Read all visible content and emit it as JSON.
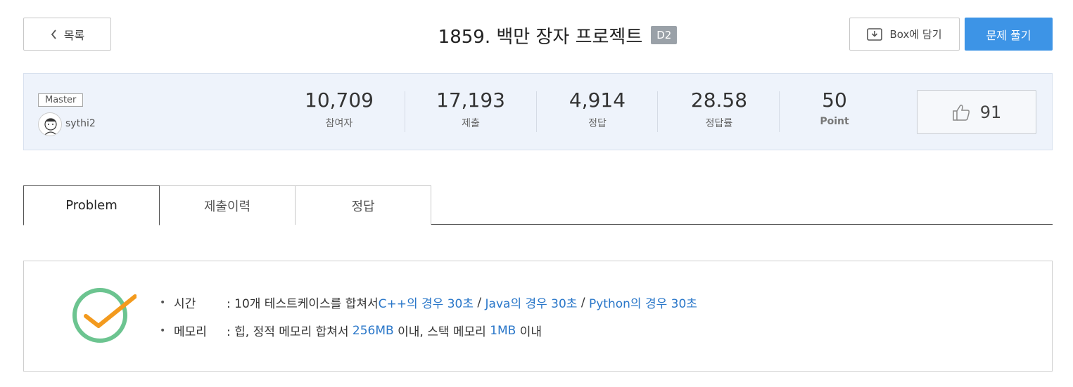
{
  "header": {
    "back_label": "목록",
    "title": "1859. 백만 장자 프로젝트",
    "level": "D2",
    "box_label": "Box에 담기",
    "solve_label": "문제 풀기"
  },
  "stats": {
    "rank": "Master",
    "username": "sythi2",
    "participants_value": "10,709",
    "participants_label": "참여자",
    "submissions_value": "17,193",
    "submissions_label": "제출",
    "correct_value": "4,914",
    "correct_label": "정답",
    "rate_value": "28.58",
    "rate_label": "정답률",
    "point_value": "50",
    "point_label": "Point",
    "likes": "91"
  },
  "tabs": {
    "problem": "Problem",
    "history": "제출이력",
    "answer": "정답"
  },
  "constraints": {
    "bullet": "•",
    "time_key": "시간",
    "time_prefix": ": 10개 테스트케이스를 합쳐서 ",
    "cpp": "C++의 경우 30초",
    "sep1": " / ",
    "java": "Java의 경우 30초",
    "sep2": " / ",
    "python": "Python의 경우 30초",
    "memory_key": "메모리",
    "memory_prefix": ": 힙, 정적 메모리 합쳐서 ",
    "heap_size": "256MB",
    "memory_mid": " 이내, 스택 메모리 ",
    "stack_size": "1MB",
    "memory_suffix": " 이내"
  },
  "colors": {
    "accent": "#3d94e6",
    "link_blue": "#2a77c9",
    "check_green": "#6cc490",
    "check_orange": "#f39a1e",
    "badge_gray": "#9aa1a8"
  }
}
